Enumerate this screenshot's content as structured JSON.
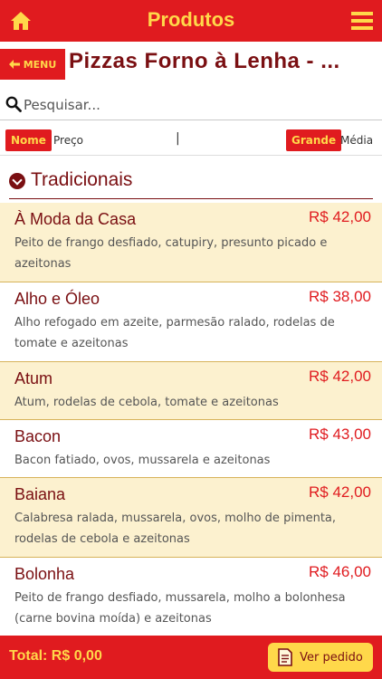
{
  "topbar": {
    "title": "Produtos",
    "home_icon": "home-icon",
    "menu_icon": "hamburger-menu-icon"
  },
  "heading": {
    "menu_button_label": "MENU",
    "page_title": "Pizzas Forno à Lenha - ..."
  },
  "search": {
    "placeholder": "Pesquisar..."
  },
  "sort": {
    "name_label": "Nome",
    "price_label": "Preço",
    "separator": "|",
    "large_label": "Grande",
    "medium_label": "Média"
  },
  "category": {
    "label": "Tradicionais"
  },
  "items": [
    {
      "name": "À Moda da Casa",
      "price": "R$ 42,00",
      "desc": "Peito de frango desfiado, catupiry, presunto picado e azeitonas"
    },
    {
      "name": "Alho e Óleo",
      "price": "R$ 38,00",
      "desc": "Alho refogado em azeite, parmesão ralado, rodelas de tomate e azeitonas"
    },
    {
      "name": "Atum",
      "price": "R$ 42,00",
      "desc": "Atum, rodelas de cebola, tomate e azeitonas"
    },
    {
      "name": "Bacon",
      "price": "R$ 43,00",
      "desc": "Bacon fatiado, ovos, mussarela e azeitonas"
    },
    {
      "name": "Baiana",
      "price": "R$ 42,00",
      "desc": "Calabresa ralada, mussarela, ovos, molho de pimenta, rodelas de cebola e azeitonas"
    },
    {
      "name": "Bolonha",
      "price": "R$ 46,00",
      "desc": "Peito de frango desfiado, mussarela, molho a bolonhesa (carne bovina moída) e azeitonas"
    }
  ],
  "footer": {
    "total": "Total: R$ 0,00",
    "order_button_label": "Ver pedido"
  },
  "colors": {
    "brand_red": "#e01b1f",
    "brand_yellow": "#ffd84a",
    "dark_red": "#7a0f12",
    "highlight": "#fcf1cf"
  }
}
